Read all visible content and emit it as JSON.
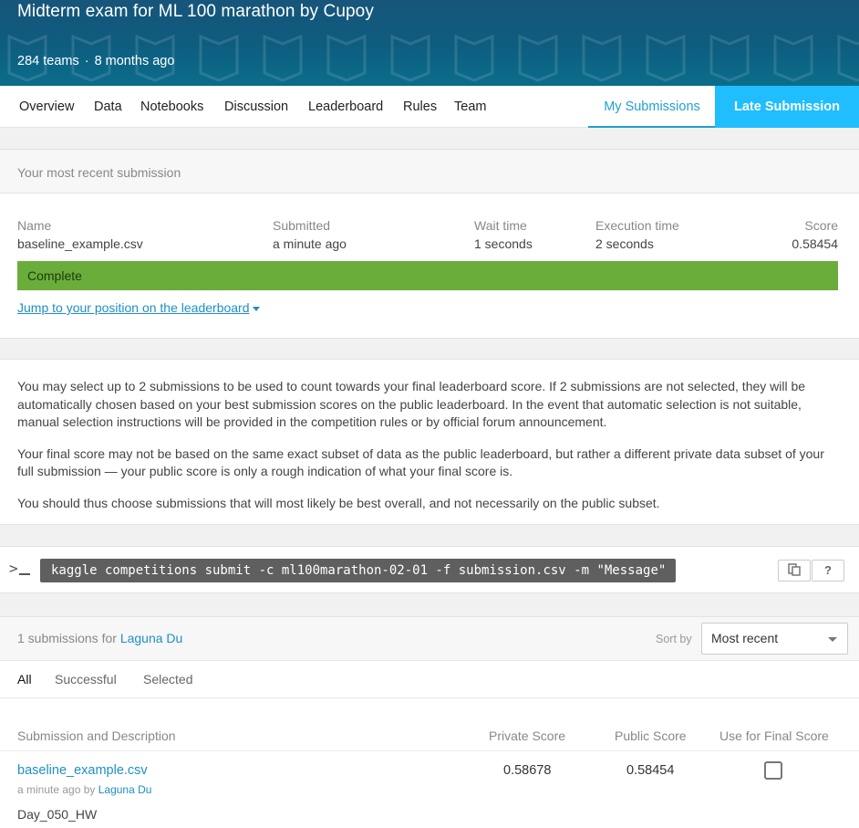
{
  "header": {
    "title": "Midterm exam for ML 100 marathon by Cupoy",
    "teams": "284 teams",
    "age": "8 months ago"
  },
  "tabs": [
    "Overview",
    "Data",
    "Notebooks",
    "Discussion",
    "Leaderboard",
    "Rules",
    "Team"
  ],
  "my_submissions_tab": "My Submissions",
  "late_submission_button": "Late Submission",
  "recent": {
    "heading": "Your most recent submission",
    "labels": {
      "name": "Name",
      "submitted": "Submitted",
      "wait": "Wait time",
      "exec": "Execution time",
      "score": "Score"
    },
    "values": {
      "name": "baseline_example.csv",
      "submitted": "a minute ago",
      "wait": "1 seconds",
      "exec": "2 seconds",
      "score": "0.58454"
    },
    "status": "Complete",
    "jump_link": "Jump to your position on the leaderboard"
  },
  "info": {
    "p1": "You may select up to 2 submissions to be used to count towards your final leaderboard score. If 2 submissions are not selected, they will be automatically chosen based on your best submission scores on the public leaderboard. In the event that automatic selection is not suitable, manual selection instructions will be provided in the competition rules or by official forum announcement.",
    "p2": "Your final score may not be based on the same exact subset of data as the public leaderboard, but rather a different private data subset of your full submission — your public score is only a rough indication of what your final score is.",
    "p3": "You should thus choose submissions that will most likely be best overall, and not necessarily on the public subset."
  },
  "cli": {
    "prompt": ">",
    "command": "kaggle competitions submit -c ml100marathon-02-01 -f submission.csv -m \"Message\"",
    "help": "?"
  },
  "submissions": {
    "count_text": "1 submissions for",
    "user": "Laguna Du",
    "sort_label": "Sort by",
    "sort_value": "Most recent",
    "filters": [
      "All",
      "Successful",
      "Selected"
    ],
    "columns": {
      "desc": "Submission and Description",
      "private": "Private Score",
      "public": "Public Score",
      "final": "Use for Final Score"
    },
    "rows": [
      {
        "file": "baseline_example.csv",
        "meta_prefix": "a minute ago by",
        "user": "Laguna Du",
        "description": "Day_050_HW",
        "private": "0.58678",
        "public": "0.58454",
        "selected": false
      }
    ]
  },
  "colors": {
    "accent": "#20beff",
    "link": "#1f8fc5",
    "complete": "#6aad3a",
    "banner": "#0e5c7f"
  }
}
